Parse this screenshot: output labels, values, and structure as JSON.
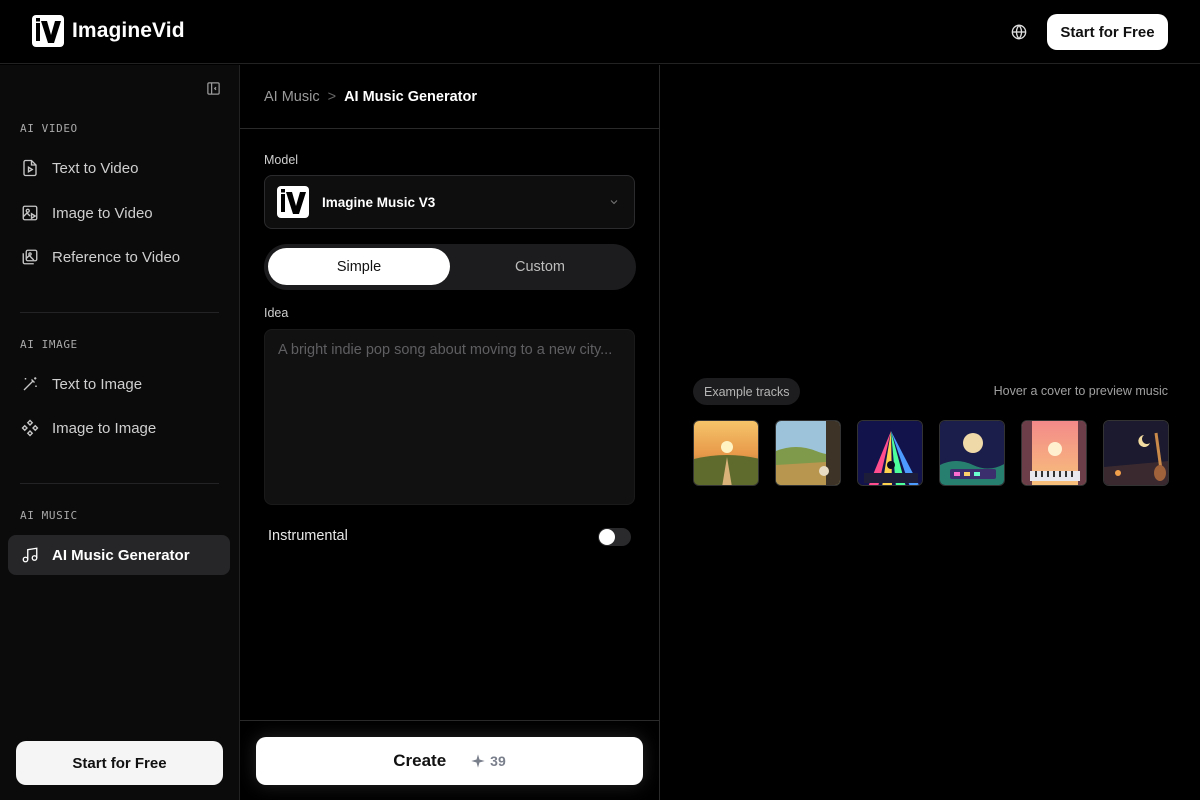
{
  "header": {
    "brand": "ImagineVid",
    "cta_label": "Start for Free",
    "globe_icon": "globe-icon"
  },
  "sidebar": {
    "sections": [
      {
        "title": "AI VIDEO",
        "items": [
          {
            "label": "Text to Video",
            "icon": "file-play-icon"
          },
          {
            "label": "Image to Video",
            "icon": "image-play-icon"
          },
          {
            "label": "Reference to Video",
            "icon": "images-icon"
          }
        ]
      },
      {
        "title": "AI IMAGE",
        "items": [
          {
            "label": "Text to Image",
            "icon": "magic-wand-icon"
          },
          {
            "label": "Image to Image",
            "icon": "components-icon"
          }
        ]
      },
      {
        "title": "AI MUSIC",
        "items": [
          {
            "label": "AI Music Generator",
            "icon": "music-note-icon",
            "active": true
          }
        ]
      }
    ],
    "cta_label": "Start for Free"
  },
  "main": {
    "breadcrumb": {
      "parent": "AI Music",
      "separator": ">",
      "current": "AI Music Generator"
    },
    "model_label": "Model",
    "model_value": "Imagine Music V3",
    "modes": [
      "Simple",
      "Custom"
    ],
    "active_mode": "Simple",
    "idea_label": "Idea",
    "idea_placeholder": "A bright indie pop song about moving to a new city...",
    "idea_value": "",
    "instrumental_label": "Instrumental",
    "instrumental_on": false,
    "create_label": "Create",
    "credits": "39"
  },
  "preview": {
    "pill": "Example tracks",
    "hint": "Hover a cover to preview music",
    "covers": [
      {
        "name": "cover-country-road"
      },
      {
        "name": "cover-meadow-window"
      },
      {
        "name": "cover-neon-stage"
      },
      {
        "name": "cover-moon-synth"
      },
      {
        "name": "cover-sunset-piano"
      },
      {
        "name": "cover-night-guitar"
      }
    ]
  },
  "colors": {
    "background": "#000000",
    "sidebar_bg": "#0b0b0c",
    "active_item": "#262628",
    "primary_button": "#ffffff"
  }
}
